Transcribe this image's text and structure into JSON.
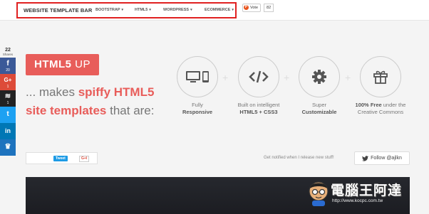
{
  "topbar": {
    "brand": "WEBSITE TEMPLATE BAR",
    "nav": [
      "BOOTSTRAP",
      "HTML5",
      "WORDPRESS",
      "ECOMMERCE"
    ],
    "caret": "▾",
    "vote_label": "Vote",
    "vote_count": "82"
  },
  "share_bar": {
    "total": "22",
    "total_label": "Shares",
    "buttons": [
      {
        "glyph": "f",
        "count": "20",
        "color": "#3b5998",
        "icon": "facebook-icon"
      },
      {
        "glyph": "G+",
        "count": "1",
        "color": "#dd4b39",
        "icon": "google-plus-icon"
      },
      {
        "glyph": "≋",
        "count": "1",
        "color": "#222222",
        "icon": "buffer-icon"
      },
      {
        "glyph": "t",
        "count": "",
        "color": "#1da1f2",
        "icon": "twitter-icon"
      },
      {
        "glyph": "in",
        "count": "",
        "color": "#0077b5",
        "icon": "linkedin-icon"
      },
      {
        "glyph": "♛",
        "count": "",
        "color": "#1e73be",
        "icon": "sumome-icon"
      }
    ]
  },
  "hero": {
    "badge_main": "HTML5",
    "badge_up": " UP",
    "line1_pre": "... makes ",
    "line1_hl": "spiffy HTML5",
    "line2_hl": "site templates",
    "line2_post": " that are:"
  },
  "features": [
    {
      "icon": "devices-icon",
      "line1": "Fully",
      "line2": "Responsive"
    },
    {
      "icon": "code-icon",
      "line1": "Built on intelligent",
      "line2": "HTML5 + CSS3"
    },
    {
      "icon": "gear-icon",
      "line1": "Super",
      "line2": "Customizable"
    },
    {
      "icon": "gift-icon",
      "line1_bold": "100% Free",
      "line1_rest": " under the",
      "line2": "Creative Commons"
    }
  ],
  "social": {
    "tweet": "Tweet",
    "gplus": "G+I",
    "notify": "Get notified when I release new stuff!",
    "follow": "Follow @ajlkn"
  },
  "watermark": {
    "text": "電腦王阿達",
    "url": "http://www.kocpc.com.tw"
  },
  "colors": {
    "accent": "#e85d5a",
    "highlight_box": "#e02020"
  }
}
